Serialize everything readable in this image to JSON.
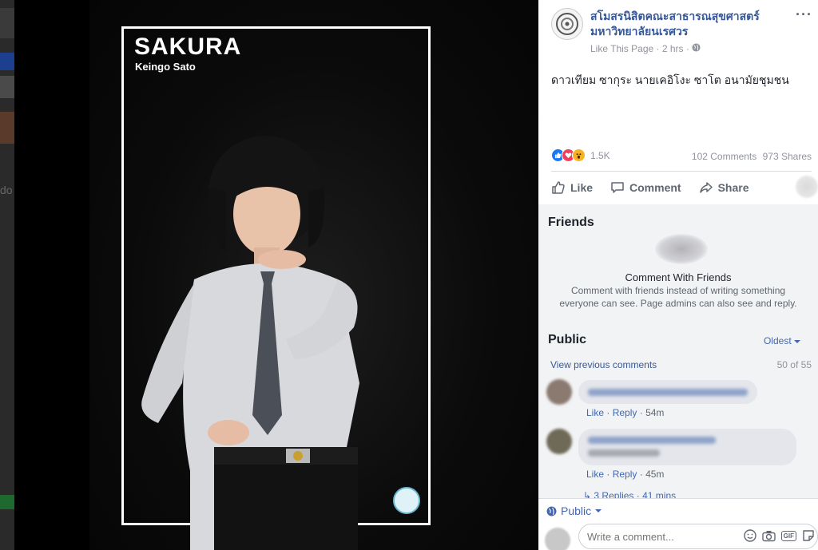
{
  "poster": {
    "title": "SAKURA",
    "subtitle": "Keingo Sato"
  },
  "backdrop": {
    "edge_text": "do"
  },
  "post": {
    "page_name": "สโมสรนิสิตคณะสาธารณสุขศาสตร์ มหาวิทยาลัยนเรศวร",
    "like_page": "Like This Page",
    "separator": "·",
    "time": "2 hrs",
    "more": "···",
    "caption": "ดาวเทียม ซากุระ นายเคอิโงะ ซาโต อนามัยชุมชน",
    "reaction_count": "1.5K",
    "comments_count": "102 Comments",
    "shares_count": "973 Shares",
    "reaction_colors": [
      "#1877f2",
      "#f33e58",
      "#f7b125"
    ]
  },
  "actions": {
    "like": "Like",
    "comment": "Comment",
    "share": "Share"
  },
  "friends": {
    "title": "Friends",
    "heading": "Comment With Friends",
    "description": "Comment with friends instead of writing something everyone can see. Page admins can also see and reply."
  },
  "public": {
    "title": "Public",
    "sort": "Oldest",
    "view_previous": "View previous comments",
    "count": "50 of 55"
  },
  "comments": [
    {
      "like": "Like",
      "reply": "Reply",
      "time": "54m"
    },
    {
      "like": "Like",
      "reply": "Reply",
      "time": "45m"
    }
  ],
  "replies_text": "3 Replies · 41 mins",
  "composer": {
    "audience": "Public",
    "placeholder": "Write a comment..."
  },
  "icons": [
    "globe-icon",
    "more-icon",
    "like-icon",
    "comment-icon",
    "share-icon",
    "emoji-icon",
    "camera-icon",
    "gif-icon",
    "sticker-icon",
    "caret-down-icon"
  ]
}
